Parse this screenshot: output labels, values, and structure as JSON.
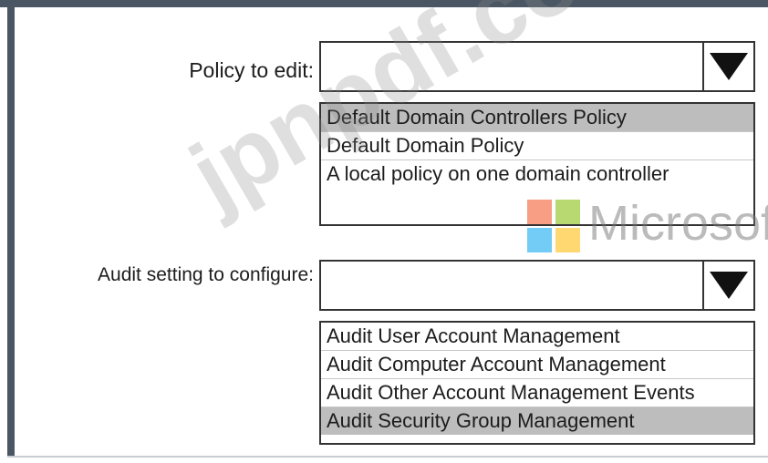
{
  "policy": {
    "label": "Policy to edit:",
    "value": "",
    "options": [
      {
        "label": "Default Domain Controllers Policy",
        "selected": true
      },
      {
        "label": "Default Domain Policy",
        "selected": false
      },
      {
        "label": "A local policy on one domain controller",
        "selected": false
      }
    ]
  },
  "audit": {
    "label": "Audit setting to configure:",
    "value": "",
    "options": [
      {
        "label": "Audit User Account Management",
        "selected": false
      },
      {
        "label": "Audit Computer Account Management",
        "selected": false
      },
      {
        "label": "Audit Other Account Management Events",
        "selected": false
      },
      {
        "label": "Audit Security Group Management",
        "selected": true
      }
    ]
  },
  "watermark": {
    "site": "jpnpdf.com",
    "brand": "Microsoft",
    "logo_colors": [
      "#f25022",
      "#7fba00",
      "#00a4ef",
      "#ffb900"
    ]
  },
  "colors": {
    "frame": "#4a5663",
    "selected_option_bg": "#bdbdbd"
  }
}
